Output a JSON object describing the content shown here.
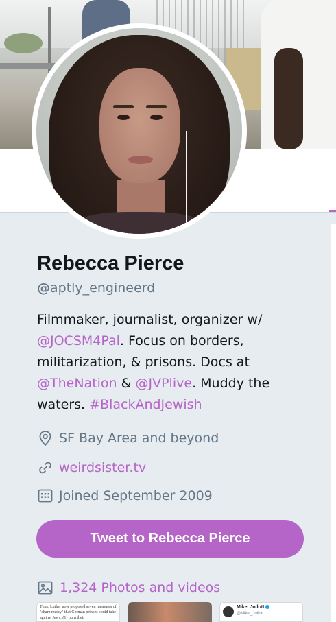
{
  "profile": {
    "name": "Rebecca Pierce",
    "handle_at": "@",
    "handle_user": "aptly_engineerd",
    "bio": {
      "p1": "Filmmaker, journalist, organizer w/ ",
      "m1": "@JOCSM4Pal",
      "p2": ". Focus on borders, militarization, & prisons. Docs at ",
      "m2": "@TheNation",
      "p3": " & ",
      "m3": "@JVPlive",
      "p4": ". Muddy the waters. ",
      "h1": "#BlackAndJewish"
    },
    "location": "SF Bay Area and beyond",
    "url": "weirdsister.tv",
    "joined": "Joined September 2009"
  },
  "actions": {
    "tweet_to": "Tweet to Rebecca Pierce"
  },
  "media": {
    "photos_label": "1,324 Photos and videos",
    "thumb1_text": "Thus, Luther now proposed seven measures of \"sharp mercy\" that German princes could take against Jews: (1) burn their",
    "thumb3_name": "Mikel Jollott",
    "thumb3_handle": "@Mikel_Jollott"
  },
  "icons": {
    "location": "location-pin-icon",
    "url": "link-icon",
    "joined": "calendar-icon",
    "photos": "image-icon"
  },
  "colors": {
    "accent": "#b565c7",
    "background": "#e6ecf0",
    "secondary_text": "#657786"
  }
}
